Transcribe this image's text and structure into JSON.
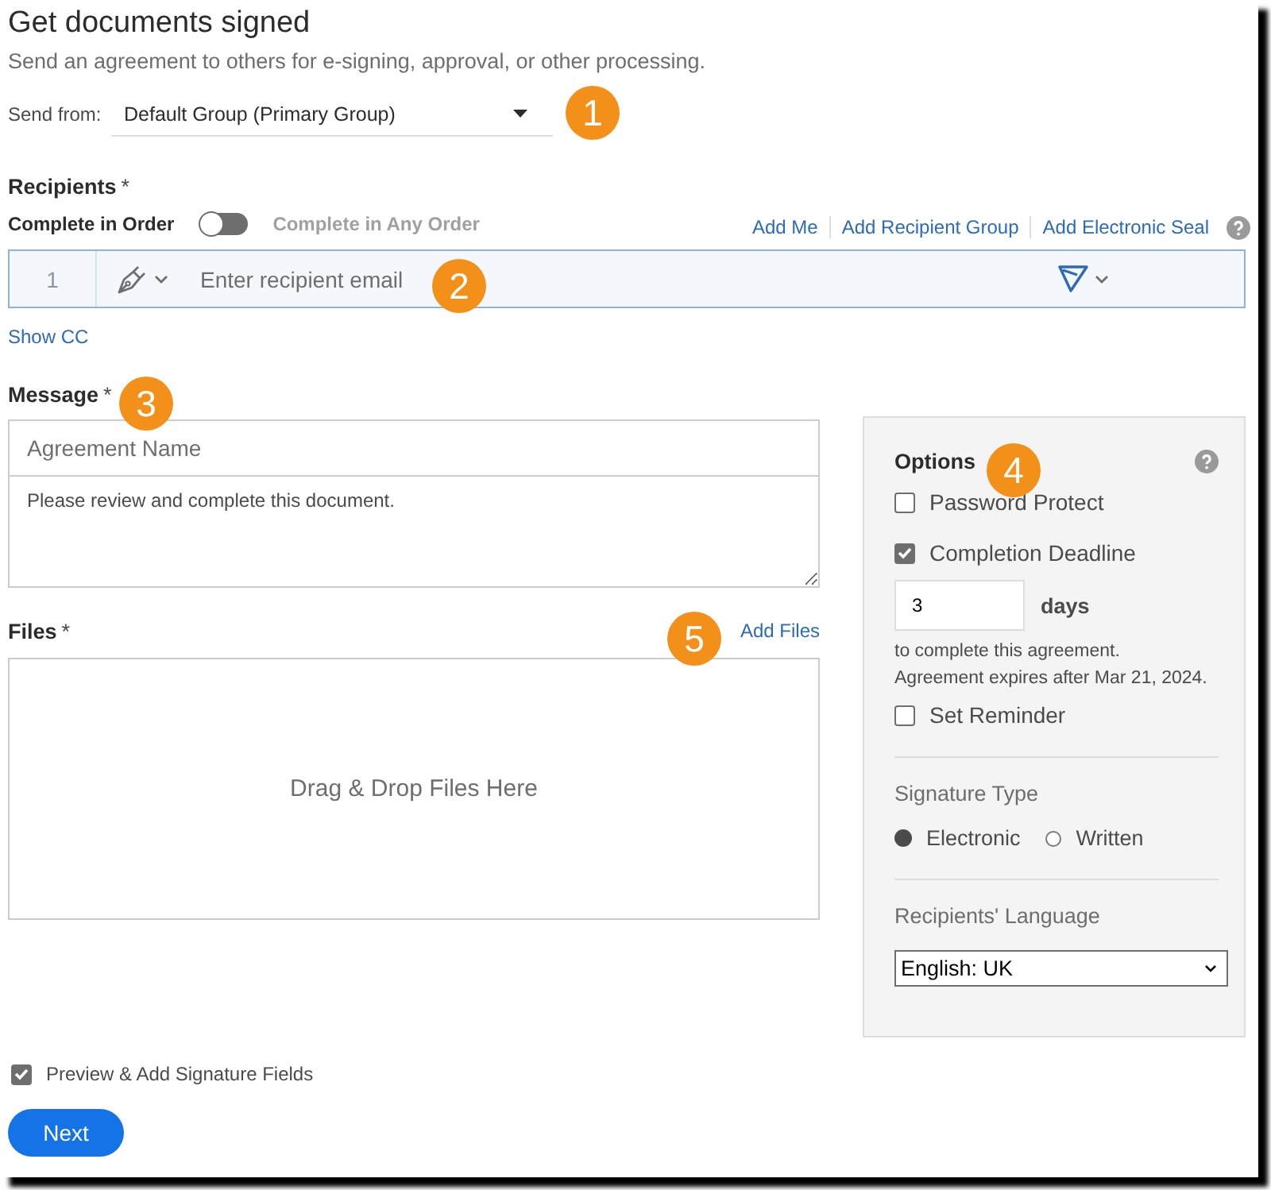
{
  "header": {
    "title": "Get documents signed",
    "subtitle": "Send an agreement to others for e-signing, approval, or other processing."
  },
  "send_from": {
    "label": "Send from:",
    "value": "Default Group (Primary Group)"
  },
  "recipients": {
    "label": "Recipients",
    "required_mark": "*",
    "order_options": [
      {
        "label": "Complete in Order",
        "selected": true
      },
      {
        "label": "Complete in Any Order",
        "selected": false
      }
    ],
    "links": [
      "Add Me",
      "Add Recipient Group",
      "Add Electronic Seal"
    ],
    "rows": [
      {
        "number": "1",
        "placeholder": "Enter recipient email"
      }
    ],
    "show_cc": "Show CC"
  },
  "message": {
    "label": "Message",
    "required_mark": "*",
    "name_placeholder": "Agreement Name",
    "body": "Please review and complete this document."
  },
  "files": {
    "label": "Files",
    "required_mark": "*",
    "add_link": "Add Files",
    "drop_text": "Drag & Drop Files Here"
  },
  "options": {
    "title": "Options",
    "checks": [
      {
        "label": "Password Protect",
        "checked": false
      },
      {
        "label": "Completion Deadline",
        "checked": true
      }
    ],
    "deadline_value": "3",
    "deadline_unit": "days",
    "deadline_note": "to complete this agreement.",
    "expiry_note": "Agreement expires after Mar 21, 2024.",
    "reminder": {
      "label": "Set Reminder",
      "checked": false
    },
    "signature_type": {
      "label": "Signature Type",
      "choices": [
        {
          "label": "Electronic",
          "selected": true
        },
        {
          "label": "Written",
          "selected": false
        }
      ]
    },
    "language": {
      "label": "Recipients' Language",
      "value": "English: UK"
    }
  },
  "preview": {
    "label": "Preview & Add Signature Fields",
    "checked": true
  },
  "next_button": "Next",
  "callouts": [
    {
      "number": "1"
    },
    {
      "number": "2"
    },
    {
      "number": "3"
    },
    {
      "number": "4"
    },
    {
      "number": "5"
    }
  ]
}
